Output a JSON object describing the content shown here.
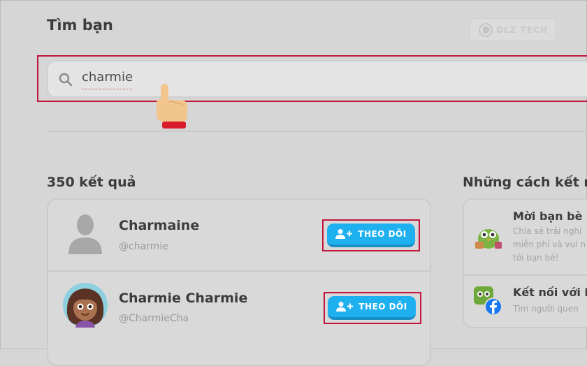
{
  "page": {
    "title": "Tìm bạn",
    "watermark": "DLZ TECH"
  },
  "search": {
    "value": "charmie"
  },
  "results": {
    "count_label": "350 kết quả",
    "users": [
      {
        "name": "Charmaine",
        "handle": "@charmie",
        "follow_label": "THEO DÕI"
      },
      {
        "name": "Charmie Charmie",
        "handle": "@CharmieCha",
        "follow_label": "THEO DÕI"
      }
    ]
  },
  "ways": {
    "title": "Những cách kết nố",
    "items": [
      {
        "title": "Mời bạn bè",
        "desc_lines": [
          "Chia sẻ trải nghi",
          "miễn phí và vui n",
          "tới bạn bè!"
        ]
      },
      {
        "title": "Kết nối với F",
        "desc_lines": [
          "Tìm người quen"
        ]
      }
    ]
  },
  "colors": {
    "follow_button": "#1fb0f0",
    "highlight": "#c0163a",
    "background": "#d6d6d6"
  }
}
